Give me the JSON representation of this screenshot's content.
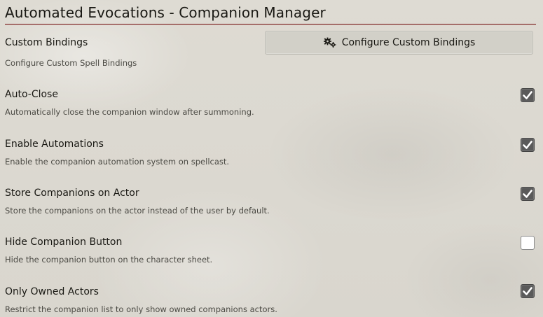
{
  "window": {
    "title": "Automated Evocations - Companion Manager"
  },
  "custom_bindings": {
    "label": "Custom Bindings",
    "hint": "Configure Custom Spell Bindings",
    "button_label": "Configure Custom Bindings",
    "button_icon": "cogs-icon"
  },
  "settings": [
    {
      "label": "Auto-Close",
      "hint": "Automatically close the companion window after summoning.",
      "checked": true
    },
    {
      "label": "Enable Automations",
      "hint": "Enable the companion automation system on spellcast.",
      "checked": true
    },
    {
      "label": "Store Companions on Actor",
      "hint": "Store the companions on the actor instead of the user by default.",
      "checked": true
    },
    {
      "label": "Hide Companion Button",
      "hint": "Hide the companion button on the character sheet.",
      "checked": false
    },
    {
      "label": "Only Owned Actors",
      "hint": "Restrict the companion list to only show owned companions actors.",
      "checked": true
    }
  ],
  "colors": {
    "header_rule": "#7a1a1a",
    "checkbox_checked": "#5a5a5a",
    "checkbox_unchecked": "#ffffff",
    "text": "#191813",
    "hint_text": "#4b4a44"
  }
}
